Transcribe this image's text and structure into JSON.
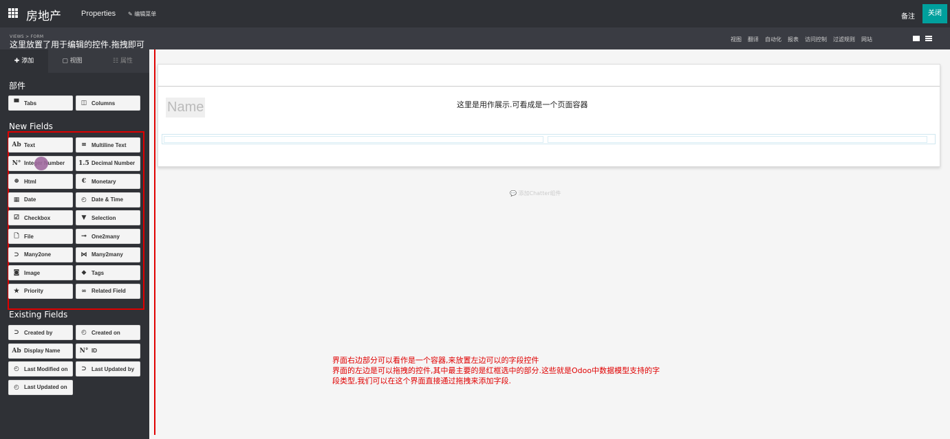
{
  "topbar": {
    "app_title": "房地产",
    "properties_menu": "Properties",
    "edit_menu": "✎ 编辑菜单",
    "notes": "备注",
    "close": "关闭"
  },
  "subbar": {
    "views_path": "VIEWS > FORM",
    "drag_hint": "这里放置了用于编辑的控件.拖拽即可",
    "menu": [
      "视图",
      "翻译",
      "自动化",
      "报表",
      "访问控制",
      "过滤规则",
      "网站"
    ]
  },
  "sidebar": {
    "tabs": {
      "add": "✚ 添加",
      "view": "▢ 视图",
      "props": "☷ 属性"
    },
    "parts_title": "部件",
    "parts": [
      {
        "label": "Tabs",
        "icon": "tabs-icon"
      },
      {
        "label": "Columns",
        "icon": "columns-icon"
      }
    ],
    "new_fields_title": "New Fields",
    "new_fields": [
      {
        "label": "Text",
        "glyph": "Ab"
      },
      {
        "label": "Multiline Text",
        "glyph": "≡"
      },
      {
        "label": "Integer Number",
        "glyph": "N°"
      },
      {
        "label": "Decimal Number",
        "glyph": "1.5"
      },
      {
        "label": "Html",
        "glyph": "⊕"
      },
      {
        "label": "Monetary",
        "glyph": "€"
      },
      {
        "label": "Date",
        "glyph": "▦"
      },
      {
        "label": "Date & Time",
        "glyph": "◴"
      },
      {
        "label": "Checkbox",
        "glyph": "☑"
      },
      {
        "label": "Selection",
        "glyph": "▼"
      },
      {
        "label": "File",
        "glyph": "🗋"
      },
      {
        "label": "One2many",
        "glyph": "⊸"
      },
      {
        "label": "Many2one",
        "glyph": "⊃"
      },
      {
        "label": "Many2many",
        "glyph": "⋈"
      },
      {
        "label": "Image",
        "glyph": "◙"
      },
      {
        "label": "Tags",
        "glyph": "◆"
      },
      {
        "label": "Priority",
        "glyph": "★"
      },
      {
        "label": "Related Field",
        "glyph": "∞"
      }
    ],
    "existing_fields_title": "Existing Fields",
    "existing_fields": [
      {
        "label": "Created by",
        "glyph": "⊃"
      },
      {
        "label": "Created on",
        "glyph": "◴"
      },
      {
        "label": "Display Name",
        "glyph": "Ab"
      },
      {
        "label": "ID",
        "glyph": "N°"
      },
      {
        "label": "Last Modified on",
        "glyph": "◴"
      },
      {
        "label": "Last Updated by",
        "glyph": "⊃"
      },
      {
        "label": "Last Updated on",
        "glyph": "◴"
      }
    ]
  },
  "sheet": {
    "name_placeholder": "Name",
    "container_note": "这里是用作展示.可看成是一个页面容器"
  },
  "chatter": "💬 添加Chatter组件",
  "explanation": [
    "界面右边部分可以看作是一个容器,来放置左边可以的字段控件",
    "界面的左边是可以拖拽的控件,其中最主要的是红框选中的部分.这些就是Odoo中数据模型支持的字",
    "段类型,我们可以在这个界面直接通过拖拽来添加字段."
  ],
  "colors": {
    "accent": "#00a09d",
    "annotation": "#e00000",
    "navbar": "#2f3136"
  }
}
